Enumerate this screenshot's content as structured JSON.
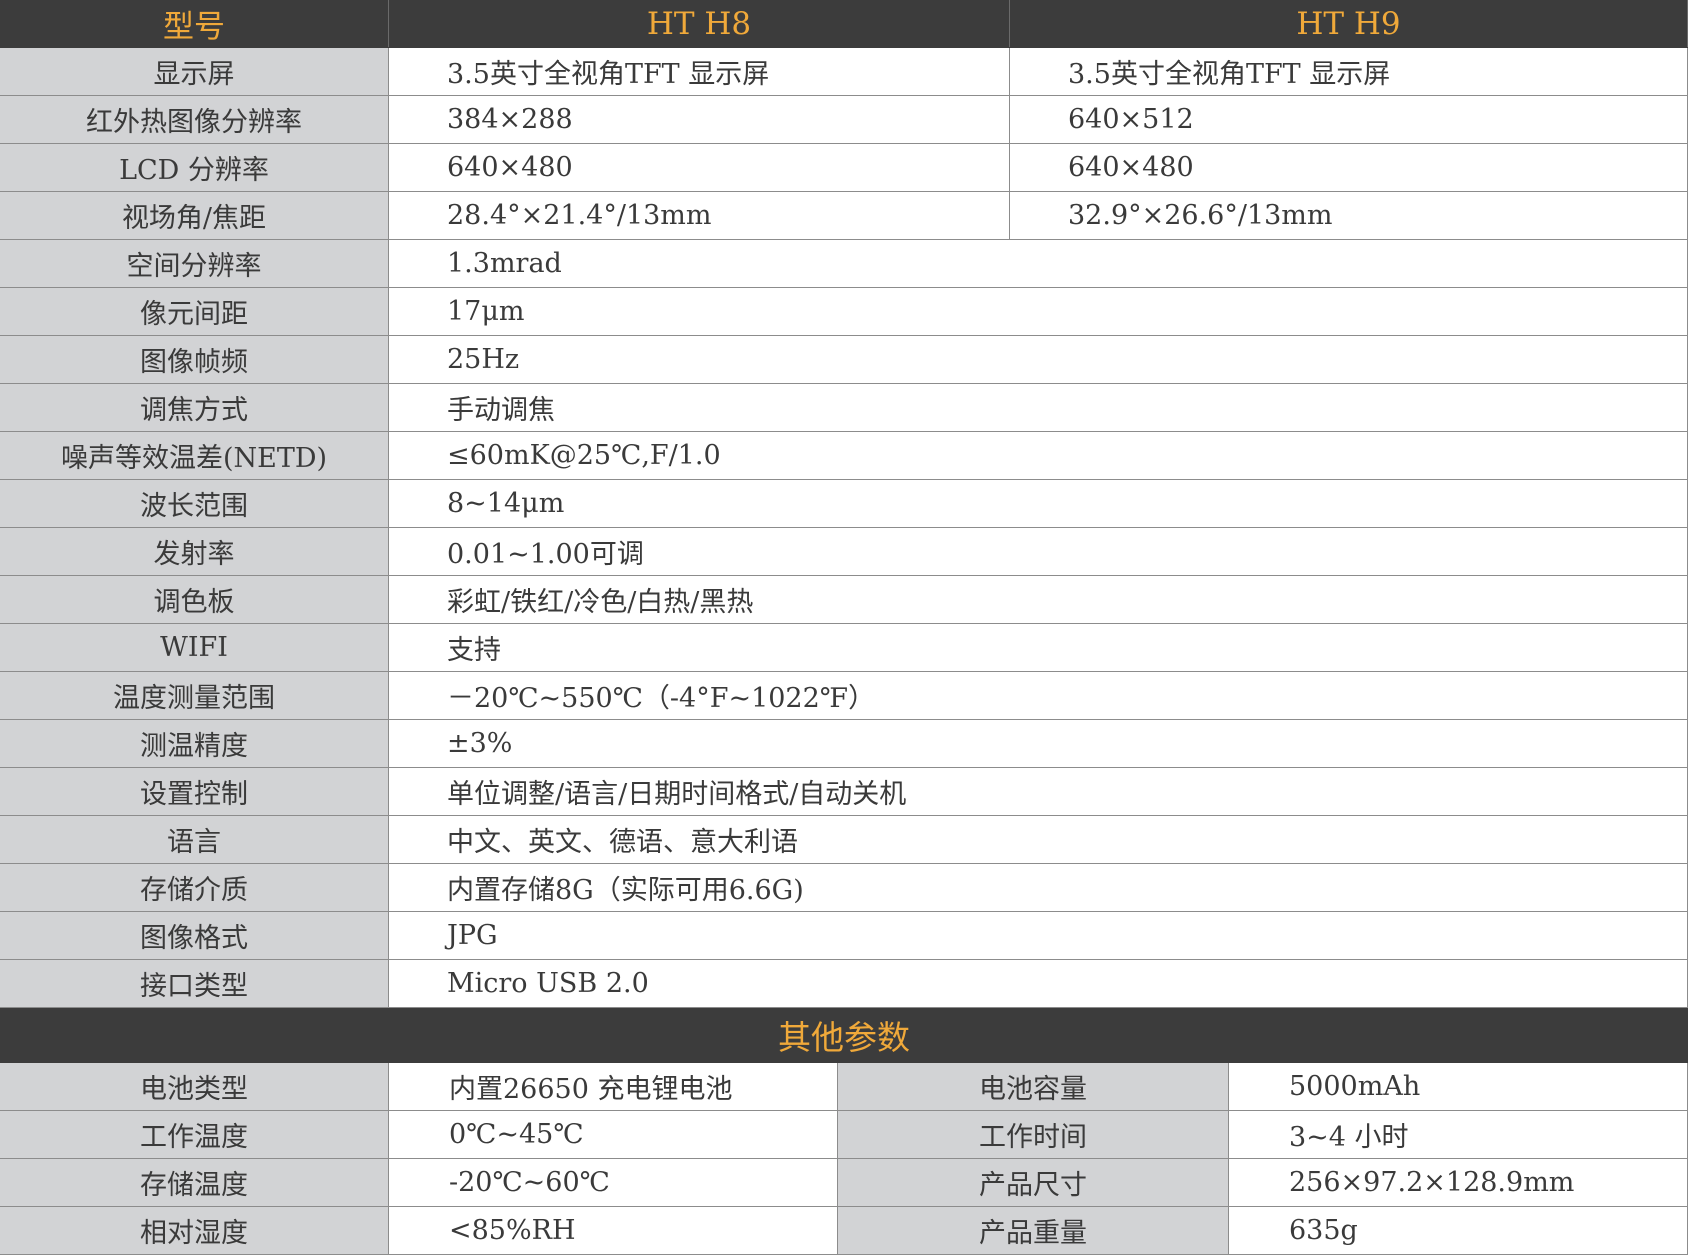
{
  "header": {
    "model_label": "型号",
    "model_h8": "HT H8",
    "model_h9": "HT H9"
  },
  "split_rows": [
    {
      "label": "显示屏",
      "h8": "3.5英寸全视角TFT 显示屏",
      "h9": "3.5英寸全视角TFT 显示屏"
    },
    {
      "label": "红外热图像分辨率",
      "h8": "384×288",
      "h9": "640×512"
    },
    {
      "label": "LCD 分辨率",
      "h8": "640×480",
      "h9": "640×480"
    },
    {
      "label": "视场角/焦距",
      "h8": "28.4°×21.4°/13mm",
      "h9": "32.9°×26.6°/13mm"
    }
  ],
  "common_rows": [
    {
      "label": "空间分辨率",
      "value": "1.3mrad"
    },
    {
      "label": "像元间距",
      "value": "17μm"
    },
    {
      "label": "图像帧频",
      "value": "25Hz"
    },
    {
      "label": "调焦方式",
      "value": "手动调焦"
    },
    {
      "label": "噪声等效温差(NETD)",
      "value": "≤60mK@25℃,F/1.0"
    },
    {
      "label": "波长范围",
      "value": "8~14μm"
    },
    {
      "label": "发射率",
      "value": "0.01~1.00可调"
    },
    {
      "label": "调色板",
      "value": "彩虹/铁红/冷色/白热/黑热"
    },
    {
      "label": "WIFI",
      "value": "支持"
    },
    {
      "label": "温度测量范围",
      "value": "－20℃~550℃（-4°F~1022℉）"
    },
    {
      "label": "测温精度",
      "value": "±3%"
    },
    {
      "label": "设置控制",
      "value": "单位调整/语言/日期时间格式/自动关机"
    },
    {
      "label": "语言",
      "value": "中文、英文、德语、意大利语"
    },
    {
      "label": "存储介质",
      "value": "内置存储8G（实际可用6.6G)"
    },
    {
      "label": "图像格式",
      "value": "JPG"
    },
    {
      "label": "接口类型",
      "value": "Micro USB 2.0"
    }
  ],
  "other_section": {
    "title": "其他参数"
  },
  "other_rows": [
    {
      "label1": "电池类型",
      "value1": "内置26650 充电锂电池",
      "label2": "电池容量",
      "value2": "5000mAh"
    },
    {
      "label1": "工作温度",
      "value1": "0℃~45℃",
      "label2": "工作时间",
      "value2": "3~4 小时"
    },
    {
      "label1": "存储温度",
      "value1": "-20℃~60℃",
      "label2": "产品尺寸",
      "value2": "256×97.2×128.9mm"
    },
    {
      "label1": "相对湿度",
      "value1": "<85%RH",
      "label2": "产品重量",
      "value2": "635g"
    }
  ],
  "colors": {
    "header_bg": "#3c3c3c",
    "header_text": "#f0a93a",
    "label_bg": "#d2d3d5"
  }
}
